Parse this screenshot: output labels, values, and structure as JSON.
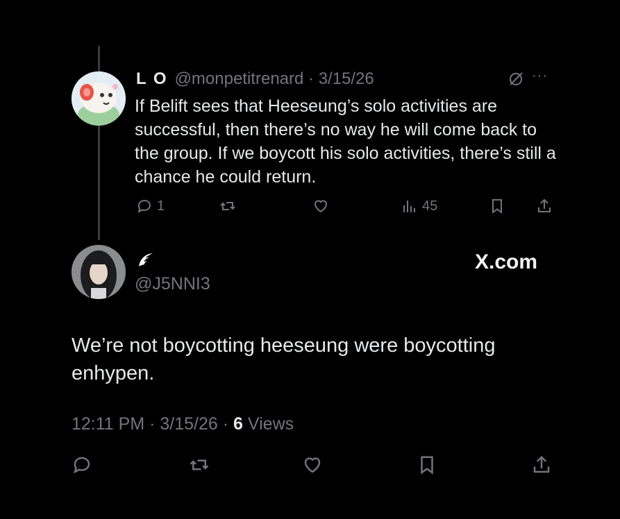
{
  "parent_tweet": {
    "display_name": "L O",
    "handle": "@monpetitrenard",
    "separator": "·",
    "date": "3/15/26",
    "text": "If Belift sees that Heeseung’s solo activities are successful, then there’s no way he will come back to the group. If we boycott his solo activities, there’s still a chance he could return.",
    "reply_count": "1",
    "views_count": "45",
    "more_label": "···"
  },
  "reply_tweet": {
    "display_name_emoji": "wing",
    "handle": "@J5NNI3",
    "text": "We’re not boycotting heeseung were boycotting enhypen.",
    "time": "12:11 PM",
    "separator": "·",
    "date": "3/15/26",
    "views_count": "6",
    "views_label": "Views"
  },
  "watermark": "X.com",
  "icons": {
    "reply": "reply-icon",
    "retweet": "retweet-icon",
    "like": "heart-icon",
    "views": "views-icon",
    "bookmark": "bookmark-icon",
    "share": "share-icon",
    "grok": "grok-icon",
    "more": "more-icon"
  },
  "colors": {
    "background": "#000000",
    "primary_text": "#e7e9ea",
    "secondary_text": "#71767b",
    "thread_line": "#3a3d40"
  }
}
